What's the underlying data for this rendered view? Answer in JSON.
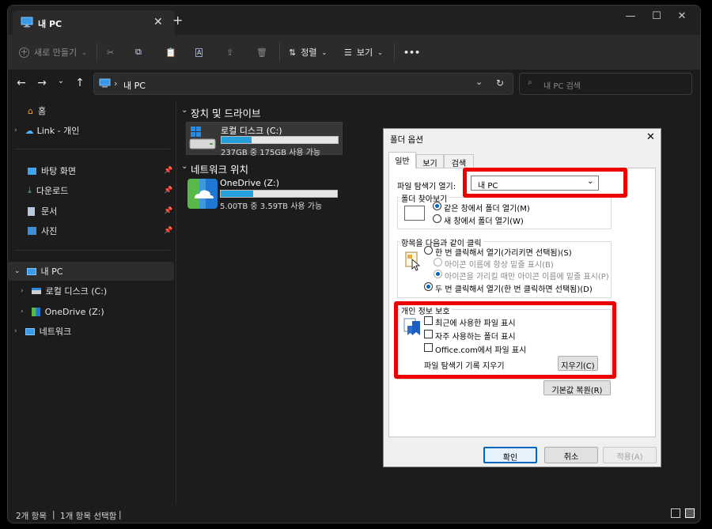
{
  "explorer": {
    "tab_title": "내 PC",
    "toolbar": {
      "new_label": "새로 만들기",
      "sort_label": "정렬",
      "view_label": "보기",
      "more": "•••"
    },
    "address": {
      "separator": "›",
      "path": "내 PC",
      "search_placeholder": "내 PC 검색"
    },
    "sidebar": {
      "home": "홈",
      "link": "Link - 개인",
      "desktop": "바탕 화면",
      "downloads": "다운로드",
      "documents": "문서",
      "pictures": "사진",
      "this_pc": "내 PC",
      "local_disk": "로컬 디스크 (C:)",
      "onedrive": "OneDrive (Z:)",
      "network": "네트워크"
    },
    "content": {
      "devices_header": "장치 및 드라이브",
      "network_header": "네트워크 위치",
      "drives": [
        {
          "name": "로컬 디스크 (C:)",
          "space": "237GB 중 175GB 사용 가능",
          "used_fraction": 0.26
        },
        {
          "name": "OneDrive (Z:)",
          "space": "5.00TB 중 3.59TB 사용 가능",
          "used_fraction": 0.28
        }
      ]
    },
    "status": {
      "items": "2개 항목",
      "sep": "|",
      "selected": "1개 항목 선택함"
    }
  },
  "dialog": {
    "title": "폴더 옵션",
    "close": "✕",
    "tabs": [
      "일반",
      "보기",
      "검색"
    ],
    "open_in_label": "파일 탐색기 열기:",
    "open_in_value": "내 PC",
    "browse_group": "폴더 찾아보기",
    "browse_opt1": "같은 창에서 폴더 열기(M)",
    "browse_opt2": "새 창에서 폴더 열기(W)",
    "click_group": "항목을 다음과 같이 클릭",
    "click_opt1": "한 번 클릭해서 열기(가리키면 선택됨)(S)",
    "click_sub1": "아이콘 이름에 항상 밑줄 표시(B)",
    "click_sub2": "아이콘을 가리킬 때만 아이콘 이름에 밑줄 표시(P)",
    "click_opt2": "두 번 클릭해서 열기(한 번 클릭하면 선택됨)(D)",
    "privacy_group": "개인 정보 보호",
    "privacy_opt1": "최근에 사용한 파일 표시",
    "privacy_opt2": "자주 사용하는 폴더 표시",
    "privacy_opt3": "Office.com에서 파일 표시",
    "clear_history_label": "파일 탐색기 기록 지우기",
    "clear_button": "지우기(C)",
    "restore_button": "기본값 복원(R)",
    "ok": "확인",
    "cancel": "취소",
    "apply": "적용(A)"
  },
  "colors": {
    "highlight_red": "#ee0000",
    "accent_blue": "#0067c0",
    "drive_bar": "#26a0da"
  }
}
